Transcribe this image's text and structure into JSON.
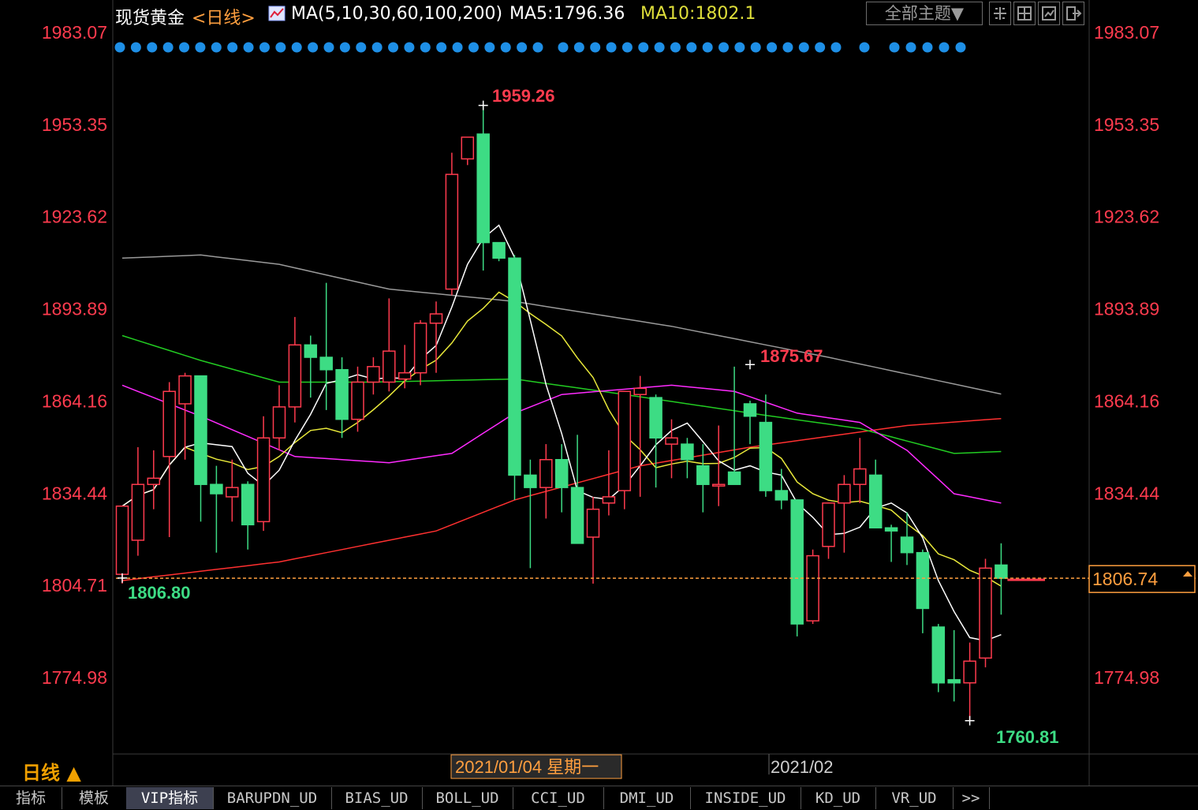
{
  "header": {
    "instrument": "现货黄金",
    "period": "<日线>",
    "ma_label": "MA(5,10,30,60,100,200)",
    "ma5": "MA5:1796.36",
    "ma10": "MA10:1802.1",
    "theme_button": "全部主题▼",
    "toolbar_icons": [
      "grid-icon",
      "split-icon",
      "chart-icon",
      "exit-icon"
    ]
  },
  "colors": {
    "up": "#ff3b4e",
    "down": "#3ddc84",
    "ma5": "#ffffff",
    "ma10": "#e8e83a",
    "ma30": "#ff2bff",
    "ma60": "#22cc22",
    "ma100": "#ff3030",
    "ma200": "#9a9a9a",
    "price_axis": "#ff3b4e",
    "dots": "#1e8fe6"
  },
  "chart_data": {
    "type": "candlestick",
    "title": "现货黄金 日线",
    "y_ticks": [
      "1983.07",
      "1953.35",
      "1923.62",
      "1893.89",
      "1864.16",
      "1834.44",
      "1804.71",
      "1774.98"
    ],
    "ylim": [
      1760.81,
      1983.07
    ],
    "x_labels": [
      "2021/01/04 星期一",
      "2021/02"
    ],
    "current_price": "1806.74",
    "annotations": {
      "high": "1959.26",
      "secondary_high": "1875.67",
      "low": "1760.81",
      "start": "1806.80"
    },
    "candles": [
      {
        "o": 1808,
        "h": 1829,
        "l": 1805,
        "c": 1830
      },
      {
        "o": 1819,
        "h": 1849,
        "l": 1814,
        "c": 1837
      },
      {
        "o": 1837,
        "h": 1848,
        "l": 1829,
        "c": 1839
      },
      {
        "o": 1846,
        "h": 1870,
        "l": 1820,
        "c": 1867
      },
      {
        "o": 1863,
        "h": 1873,
        "l": 1845,
        "c": 1872
      },
      {
        "o": 1872,
        "h": 1872,
        "l": 1825,
        "c": 1837
      },
      {
        "o": 1837,
        "h": 1843,
        "l": 1815,
        "c": 1834
      },
      {
        "o": 1833,
        "h": 1845,
        "l": 1825,
        "c": 1836
      },
      {
        "o": 1837,
        "h": 1838,
        "l": 1816,
        "c": 1824
      },
      {
        "o": 1825,
        "h": 1859,
        "l": 1822,
        "c": 1852
      },
      {
        "o": 1852,
        "h": 1869,
        "l": 1848,
        "c": 1862
      },
      {
        "o": 1862,
        "h": 1891,
        "l": 1857,
        "c": 1882
      },
      {
        "o": 1882,
        "h": 1885,
        "l": 1865,
        "c": 1878
      },
      {
        "o": 1878,
        "h": 1902,
        "l": 1861,
        "c": 1874
      },
      {
        "o": 1874,
        "h": 1878,
        "l": 1852,
        "c": 1858
      },
      {
        "o": 1858,
        "h": 1875,
        "l": 1854,
        "c": 1870
      },
      {
        "o": 1870,
        "h": 1878,
        "l": 1866,
        "c": 1875
      },
      {
        "o": 1870,
        "h": 1897,
        "l": 1867,
        "c": 1880
      },
      {
        "o": 1871,
        "h": 1882,
        "l": 1868,
        "c": 1873
      },
      {
        "o": 1873,
        "h": 1890,
        "l": 1869,
        "c": 1889
      },
      {
        "o": 1889,
        "h": 1896,
        "l": 1873,
        "c": 1892
      },
      {
        "o": 1900,
        "h": 1944,
        "l": 1898,
        "c": 1937
      },
      {
        "o": 1942,
        "h": 1947,
        "l": 1940,
        "c": 1949
      },
      {
        "o": 1950,
        "h": 1959,
        "l": 1906,
        "c": 1915
      },
      {
        "o": 1915,
        "h": 1915,
        "l": 1909,
        "c": 1910
      },
      {
        "o": 1910,
        "h": 1911,
        "l": 1832,
        "c": 1840
      },
      {
        "o": 1840,
        "h": 1845,
        "l": 1810,
        "c": 1836
      },
      {
        "o": 1836,
        "h": 1850,
        "l": 1826,
        "c": 1845
      },
      {
        "o": 1845,
        "h": 1850,
        "l": 1828,
        "c": 1836
      },
      {
        "o": 1836,
        "h": 1853,
        "l": 1821,
        "c": 1818
      },
      {
        "o": 1820,
        "h": 1833,
        "l": 1805,
        "c": 1829
      },
      {
        "o": 1831,
        "h": 1848,
        "l": 1827,
        "c": 1833
      },
      {
        "o": 1835,
        "h": 1867,
        "l": 1829,
        "c": 1867
      },
      {
        "o": 1866,
        "h": 1872,
        "l": 1833,
        "c": 1868
      },
      {
        "o": 1865,
        "h": 1866,
        "l": 1836,
        "c": 1852
      },
      {
        "o": 1850,
        "h": 1858,
        "l": 1839,
        "c": 1852
      },
      {
        "o": 1850,
        "h": 1852,
        "l": 1839,
        "c": 1845
      },
      {
        "o": 1843,
        "h": 1850,
        "l": 1828,
        "c": 1837
      },
      {
        "o": 1837,
        "h": 1856,
        "l": 1830,
        "c": 1837
      },
      {
        "o": 1841,
        "h": 1875,
        "l": 1838,
        "c": 1837
      },
      {
        "o": 1863,
        "h": 1864,
        "l": 1850,
        "c": 1859
      },
      {
        "o": 1857,
        "h": 1866,
        "l": 1833,
        "c": 1835
      },
      {
        "o": 1835,
        "h": 1842,
        "l": 1829,
        "c": 1832
      },
      {
        "o": 1832,
        "h": 1832,
        "l": 1788,
        "c": 1792
      },
      {
        "o": 1793,
        "h": 1816,
        "l": 1792,
        "c": 1814
      },
      {
        "o": 1817,
        "h": 1830,
        "l": 1813,
        "c": 1831
      },
      {
        "o": 1831,
        "h": 1840,
        "l": 1815,
        "c": 1837
      },
      {
        "o": 1837,
        "h": 1852,
        "l": 1831,
        "c": 1842
      },
      {
        "o": 1840,
        "h": 1845,
        "l": 1826,
        "c": 1823
      },
      {
        "o": 1823,
        "h": 1824,
        "l": 1812,
        "c": 1822
      },
      {
        "o": 1820,
        "h": 1828,
        "l": 1811,
        "c": 1815
      },
      {
        "o": 1815,
        "h": 1816,
        "l": 1789,
        "c": 1797
      },
      {
        "o": 1791,
        "h": 1792,
        "l": 1770,
        "c": 1773
      },
      {
        "o": 1774,
        "h": 1790,
        "l": 1767,
        "c": 1773
      },
      {
        "o": 1773,
        "h": 1786,
        "l": 1760.81,
        "c": 1780
      },
      {
        "o": 1781,
        "h": 1813,
        "l": 1778,
        "c": 1810
      },
      {
        "o": 1811,
        "h": 1818,
        "l": 1795,
        "c": 1806.74
      }
    ]
  },
  "axis_labels": {
    "period_label": "日线 ▲",
    "date_label": "2021/01/04 星期一",
    "month_label": "2021/02"
  },
  "tabs": [
    "指标",
    "模板",
    "VIP指标",
    "BARUPDN_UD",
    "BIAS_UD",
    "BOLL_UD",
    "CCI_UD",
    "DMI_UD",
    "INSIDE_UD",
    "KD_UD",
    "VR_UD",
    ">>"
  ]
}
